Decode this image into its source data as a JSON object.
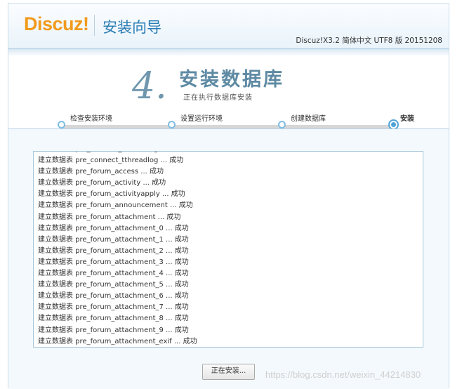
{
  "header": {
    "logo": "Discuz",
    "logo_bang": "!",
    "wizard_title": "安装向导",
    "version": "Discuz!X3.2 简体中文 UTF8 版 20151208"
  },
  "step": {
    "number": "4.",
    "title": "安装数据库",
    "subtitle": "正在执行数据库安装"
  },
  "progress": {
    "steps": [
      {
        "label": "检查安装环境"
      },
      {
        "label": "设置运行环境"
      },
      {
        "label": "创建数据库"
      },
      {
        "label": "安装"
      }
    ],
    "current_step_index": 3
  },
  "log": {
    "lines": [
      "建立数据表 pre_connect_tthreadlog ... 成功",
      "建立数据表 pre_connect_tthreadlog ... 成功",
      "建立数据表 pre_forum_access ... 成功",
      "建立数据表 pre_forum_activity ... 成功",
      "建立数据表 pre_forum_activityapply ... 成功",
      "建立数据表 pre_forum_announcement ... 成功",
      "建立数据表 pre_forum_attachment ... 成功",
      "建立数据表 pre_forum_attachment_0 ... 成功",
      "建立数据表 pre_forum_attachment_1 ... 成功",
      "建立数据表 pre_forum_attachment_2 ... 成功",
      "建立数据表 pre_forum_attachment_3 ... 成功",
      "建立数据表 pre_forum_attachment_4 ... 成功",
      "建立数据表 pre_forum_attachment_5 ... 成功",
      "建立数据表 pre_forum_attachment_6 ... 成功",
      "建立数据表 pre_forum_attachment_7 ... 成功",
      "建立数据表 pre_forum_attachment_8 ... 成功",
      "建立数据表 pre_forum_attachment_9 ... 成功",
      "建立数据表 pre_forum_attachment_exif ... 成功"
    ]
  },
  "button": {
    "label": "正在安装..."
  },
  "watermark": "https://blog.csdn.net/weixin_44214830",
  "colors": {
    "logo": "#f19a1d",
    "title_blue": "#2a7db4",
    "step_accent": "#4ea3d6"
  }
}
